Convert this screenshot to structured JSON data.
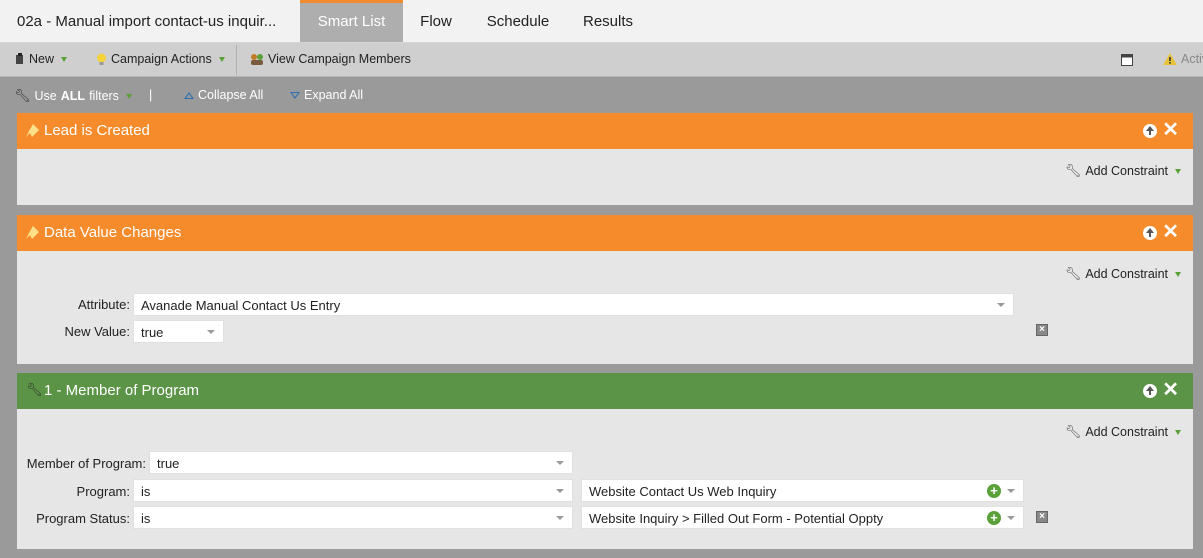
{
  "tabbar": {
    "program_title": "02a - Manual import contact-us inquir...",
    "tabs": [
      "Smart List",
      "Flow",
      "Schedule",
      "Results"
    ]
  },
  "toolbar": {
    "new_label": "New",
    "campaign_actions_label": "Campaign Actions",
    "view_members_label": "View Campaign Members",
    "activate_label": "Activ"
  },
  "filterbar": {
    "use_label_prefix": "Use",
    "use_label_bold": "ALL",
    "use_label_suffix": "filters",
    "divider": "|",
    "collapse_all": "Collapse All",
    "expand_all": "Expand All"
  },
  "filters": [
    {
      "title": "Lead is Created",
      "add_constraint": "Add Constraint"
    },
    {
      "title": "Data Value Changes",
      "add_constraint": "Add Constraint",
      "attribute_label": "Attribute:",
      "attribute_value": "Avanade Manual Contact Us Entry",
      "new_value_label": "New Value:",
      "new_value_value": "true"
    },
    {
      "title": "1 - Member of Program",
      "add_constraint": "Add Constraint",
      "member_label": "Member of Program:",
      "member_value": "true",
      "program_label": "Program:",
      "program_op": "is",
      "program_value": "Website Contact Us Web Inquiry",
      "status_label": "Program Status:",
      "status_op": "is",
      "status_value": "Website Inquiry > Filled Out Form - Potential Oppty"
    }
  ],
  "colors": {
    "trigger_header": "#f68b2c",
    "filter_header": "#5b9446",
    "active_tab_accent": "#f28a30"
  }
}
